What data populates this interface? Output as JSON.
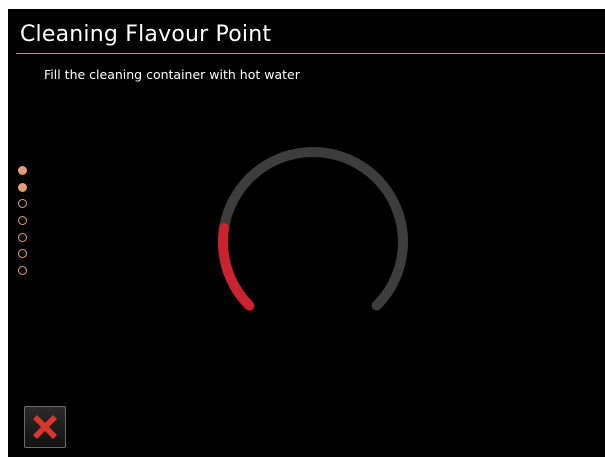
{
  "header": {
    "title": "Cleaning Flavour Point"
  },
  "instruction": "Fill the cleaning container with hot water",
  "steps": {
    "total": 7,
    "completed": 2,
    "color": "#e39d77"
  },
  "gauge": {
    "fill_fraction": 0.2,
    "track_color": "#3d3d3d",
    "fill_color": "#c8232f"
  },
  "cancel_button": {
    "icon": "close-icon",
    "color": "#d9362e"
  }
}
